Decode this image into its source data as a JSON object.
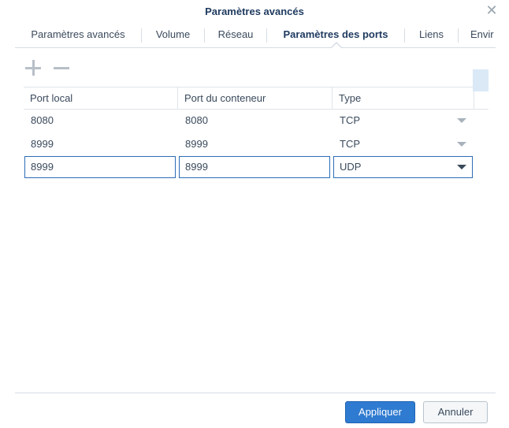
{
  "window": {
    "title": "Paramètres avancés",
    "close_icon": "close-icon"
  },
  "tabs": [
    {
      "label": "Paramètres avancés",
      "active": false
    },
    {
      "label": "Volume",
      "active": false
    },
    {
      "label": "Réseau",
      "active": false
    },
    {
      "label": "Paramètres des ports",
      "active": true
    },
    {
      "label": "Liens",
      "active": false
    },
    {
      "label": "Envir",
      "active": false
    }
  ],
  "toolbar": {
    "add_icon": "plus-icon",
    "remove_icon": "minus-icon"
  },
  "table": {
    "columns": [
      "Port local",
      "Port du conteneur",
      "Type"
    ],
    "rows": [
      {
        "local": "8080",
        "container": "8080",
        "type": "TCP"
      },
      {
        "local": "8999",
        "container": "8999",
        "type": "TCP"
      }
    ],
    "editing_row": {
      "local": "8999",
      "container": "8999",
      "type": "UDP"
    }
  },
  "footer": {
    "apply_label": "Appliquer",
    "cancel_label": "Annuler"
  },
  "colors": {
    "accent": "#2f7bd1",
    "title": "#1e3a5f",
    "text": "#3a4a5c",
    "border": "#d6dde4"
  }
}
